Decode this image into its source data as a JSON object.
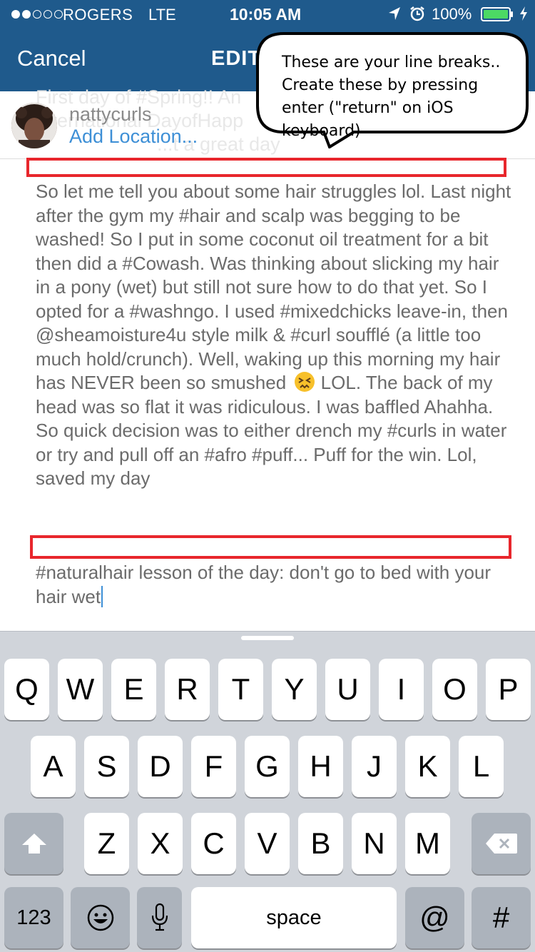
{
  "status_bar": {
    "carrier": "ROGERS",
    "network": "LTE",
    "time": "10:05 AM",
    "battery": "100%",
    "signal_bars_filled": 2,
    "signal_bars_total": 5
  },
  "nav": {
    "cancel_label": "Cancel",
    "title": "EDIT"
  },
  "post": {
    "ghost_caption": [
      "First day of #Spring!! An",
      "International DayofHapp",
      "...t a great day"
    ],
    "username": "nattycurls",
    "add_location": "Add Location..."
  },
  "caption": {
    "paragraph_1": "So let me tell you about some hair struggles lol. Last night after the gym my #hair and scalp was begging to be washed! So I put in some coconut oil treatment for a bit then did a #Cowash. Was thinking about slicking my hair in a pony (wet) but still not sure how to do that yet. So I opted for a #washngo. I used #mixedchicks leave-in, then @sheamoisture4u style milk & #curl soufflé (a little too much hold/crunch). Well, waking up this morning my hair has NEVER been so smushed",
    "paragraph_1_end": "LOL. The back of my head was so flat it was ridiculous. I was baffled Ahahha. So quick decision was to either drench my #curls in water or try and pull off an #afro #puff... Puff for the win. Lol, saved my day",
    "paragraph_2": "#naturalhair lesson of the day: don't go to bed with your hair wet"
  },
  "annotation": {
    "callout_text": "These are your line breaks.. Create these by pressing enter (\"return\" on iOS keyboard)"
  },
  "keyboard": {
    "row1": [
      "Q",
      "W",
      "E",
      "R",
      "T",
      "Y",
      "U",
      "I",
      "O",
      "P"
    ],
    "row2": [
      "A",
      "S",
      "D",
      "F",
      "G",
      "H",
      "J",
      "K",
      "L"
    ],
    "row3": [
      "Z",
      "X",
      "C",
      "V",
      "B",
      "N",
      "M"
    ],
    "numbers_label": "123",
    "space_label": "space",
    "at_label": "@",
    "hash_label": "#"
  },
  "colors": {
    "nav_bar": "#1f5a8c",
    "link": "#3d8fd6",
    "highlight_box": "#e8262c",
    "keyboard_bg": "#d0d4da"
  }
}
